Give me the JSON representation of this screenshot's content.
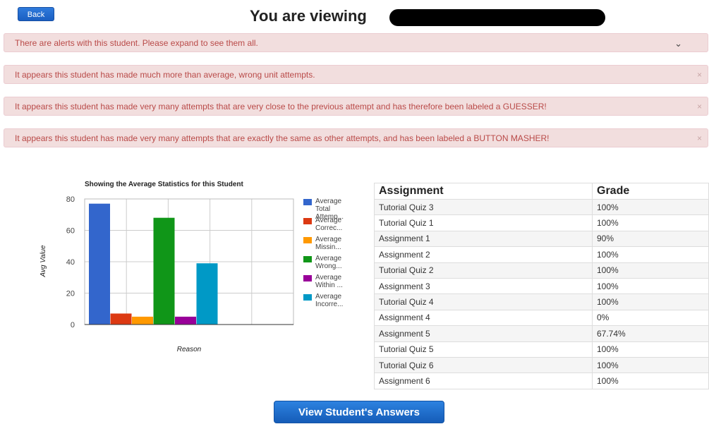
{
  "header": {
    "back_label": "Back",
    "title": "You are viewing"
  },
  "alerts": {
    "summary": "There are alerts with this student. Please expand to see them all.",
    "items": [
      "It appears this student has made much more than average, wrong unit attempts.",
      "It appears this student has made very many attempts that are very close to the previous attempt and has therefore been labeled a GUESSER!",
      "It appears this student has made very many attempts that are exactly the same as other attempts, and has been labeled a BUTTON MASHER!"
    ],
    "close_glyph": "×",
    "expand_glyph": "⌄"
  },
  "chart_data": {
    "type": "bar",
    "title": "Showing the Average Statistics for this Student",
    "xlabel": "Reason",
    "ylabel": "Avg Value",
    "ylim": [
      0,
      80
    ],
    "yticks": [
      "0",
      "20",
      "40",
      "60",
      "80"
    ],
    "grid": true,
    "legend_position": "right",
    "series": [
      {
        "name": "Average Total Attemp...",
        "value": 77,
        "color": "#3366cc"
      },
      {
        "name": "Average Correc...",
        "value": 7,
        "color": "#dc3912"
      },
      {
        "name": "Average Missin...",
        "value": 5,
        "color": "#ff9900"
      },
      {
        "name": "Average Wrong...",
        "value": 68,
        "color": "#109618"
      },
      {
        "name": "Average Within ...",
        "value": 5,
        "color": "#990099"
      },
      {
        "name": "Average Incorre...",
        "value": 39,
        "color": "#0099c6"
      }
    ]
  },
  "table": {
    "headers": [
      "Assignment",
      "Grade"
    ],
    "rows": [
      [
        "Tutorial Quiz 3",
        "100%"
      ],
      [
        "Tutorial Quiz 1",
        "100%"
      ],
      [
        "Assignment 1",
        "90%"
      ],
      [
        "Assignment 2",
        "100%"
      ],
      [
        "Tutorial Quiz 2",
        "100%"
      ],
      [
        "Assignment 3",
        "100%"
      ],
      [
        "Tutorial Quiz 4",
        "100%"
      ],
      [
        "Assignment 4",
        "0%"
      ],
      [
        "Assignment 5",
        "67.74%"
      ],
      [
        "Tutorial Quiz 5",
        "100%"
      ],
      [
        "Tutorial Quiz 6",
        "100%"
      ],
      [
        "Assignment 6",
        "100%"
      ]
    ]
  },
  "footer": {
    "answers_label": "View Student's Answers"
  }
}
